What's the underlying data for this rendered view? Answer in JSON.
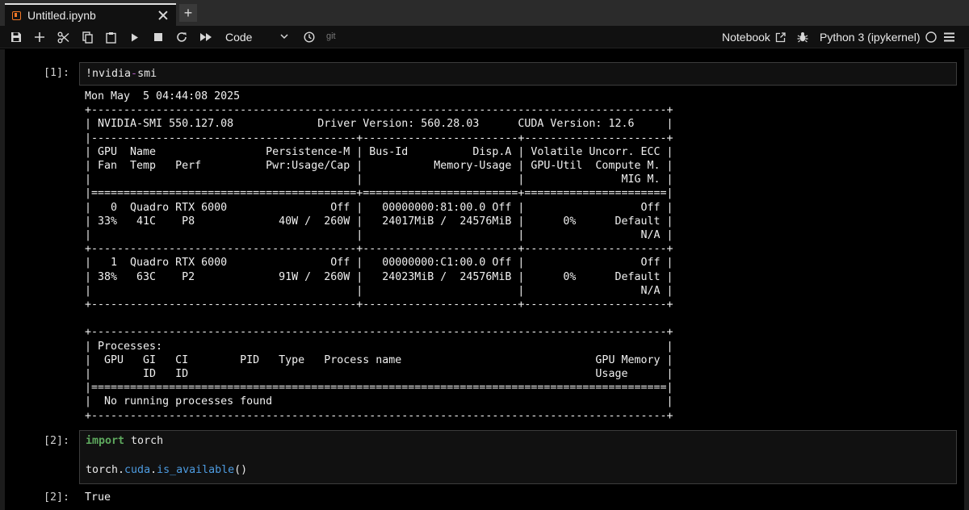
{
  "tab": {
    "title": "Untitled.ipynb",
    "add_label": "+"
  },
  "toolbar": {
    "cell_type": "Code",
    "git_label": "git",
    "notebook_label": "Notebook",
    "kernel_name": "Python 3 (ipykernel)"
  },
  "cells": [
    {
      "prompt_in": "[1]:",
      "source": {
        "bang": "!nvidia",
        "dash": "-",
        "rest": "smi"
      },
      "output": "Mon May  5 04:44:08 2025       \n+-----------------------------------------------------------------------------------------+\n| NVIDIA-SMI 550.127.08             Driver Version: 560.28.03      CUDA Version: 12.6     |\n|-----------------------------------------+------------------------+----------------------+\n| GPU  Name                 Persistence-M | Bus-Id          Disp.A | Volatile Uncorr. ECC |\n| Fan  Temp   Perf          Pwr:Usage/Cap |           Memory-Usage | GPU-Util  Compute M. |\n|                                         |                        |               MIG M. |\n|=========================================+========================+======================|\n|   0  Quadro RTX 6000                Off |   00000000:81:00.0 Off |                  Off |\n| 33%   41C    P8             40W /  260W |   24017MiB /  24576MiB |      0%      Default |\n|                                         |                        |                  N/A |\n+-----------------------------------------+------------------------+----------------------+\n|   1  Quadro RTX 6000                Off |   00000000:C1:00.0 Off |                  Off |\n| 38%   63C    P2             91W /  260W |   24023MiB /  24576MiB |      0%      Default |\n|                                         |                        |                  N/A |\n+-----------------------------------------+------------------------+----------------------+\n                                                                                         \n+-----------------------------------------------------------------------------------------+\n| Processes:                                                                              |\n|  GPU   GI   CI        PID   Type   Process name                              GPU Memory |\n|        ID   ID                                                               Usage      |\n|=========================================================================================|\n|  No running processes found                                                             |\n+-----------------------------------------------------------------------------------------+"
    },
    {
      "prompt_in": "[2]:",
      "source": {
        "line1_kw": "import",
        "line1_rest": " torch",
        "line2_obj": "torch",
        "line2_dot1": ".",
        "line2_attr1": "cuda",
        "line2_dot2": ".",
        "line2_attr2": "is_available",
        "line2_call": "()"
      },
      "prompt_out": "[2]:",
      "output": "True"
    }
  ]
}
